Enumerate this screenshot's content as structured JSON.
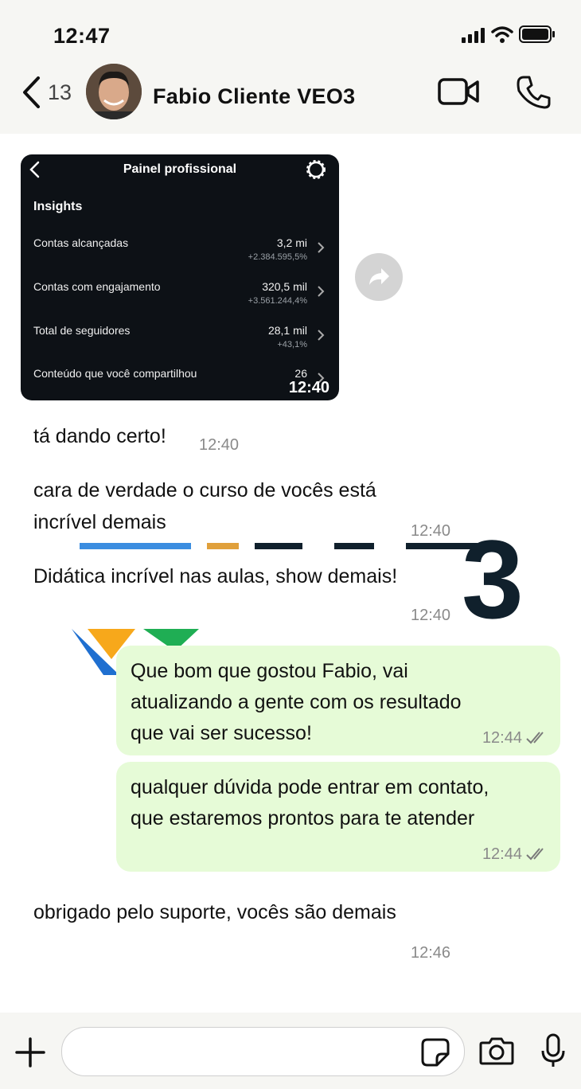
{
  "status": {
    "time": "12:47"
  },
  "header": {
    "back_count": "13",
    "contact_name": "Fabio Cliente VEO3"
  },
  "image_message": {
    "panel_title": "Painel profissional",
    "insights_title": "Insights",
    "metrics": [
      {
        "label": "Contas alcançadas",
        "value": "3,2 mi",
        "delta": "+2.384.595,5%"
      },
      {
        "label": "Contas com engajamento",
        "value": "320,5 mil",
        "delta": "+3.561.244,4%"
      },
      {
        "label": "Total de seguidores",
        "value": "28,1 mil",
        "delta": "+43,1%"
      },
      {
        "label": "Conteúdo que você compartilhou",
        "value": "26",
        "delta": ""
      }
    ],
    "time": "12:40"
  },
  "messages": [
    {
      "direction": "in",
      "text": "tá dando certo!",
      "time": "12:40"
    },
    {
      "direction": "in",
      "text": "cara de verdade o curso de vocês está\nincrível demais",
      "time": "12:40"
    },
    {
      "direction": "in",
      "text": "Didática incrível nas aulas, show demais!",
      "time": "12:40"
    },
    {
      "direction": "out",
      "text": "Que bom que gostou Fabio, vai\natualizando a gente com os resultado\nque vai ser sucesso!",
      "time": "12:44"
    },
    {
      "direction": "out",
      "text": "qualquer dúvida pode entrar em contato,\nque estaremos prontos para te atender",
      "time": "12:44"
    },
    {
      "direction": "in",
      "text": "obrigado pelo suporte, vocês são demais",
      "time": "12:46"
    }
  ],
  "background_logo": {
    "text": "3"
  },
  "colors": {
    "outgoing_bubble": "#e6fbd7",
    "bar_background": "#f6f6f3",
    "image_background": "#0d1116"
  },
  "icons": {
    "back": "chevron-left-icon",
    "video": "video-camera-icon",
    "phone": "phone-icon",
    "forward": "forward-icon",
    "settings": "gear-icon",
    "add": "plus-icon",
    "sticker": "sticker-icon",
    "camera": "camera-icon",
    "mic": "microphone-icon"
  }
}
